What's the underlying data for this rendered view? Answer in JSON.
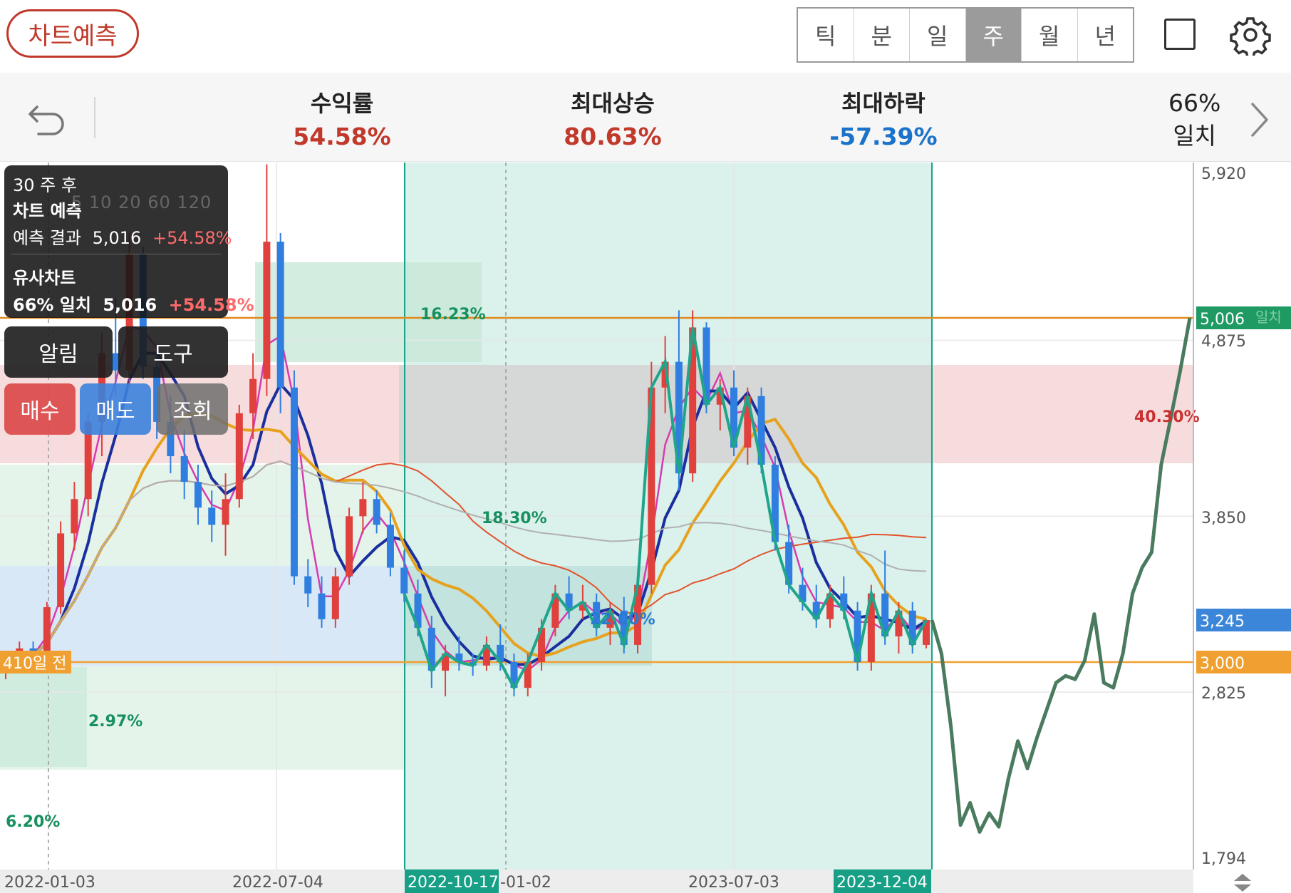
{
  "header": {
    "predict_button": "차트예측",
    "periods": [
      "틱",
      "분",
      "일",
      "주",
      "월",
      "년"
    ],
    "active_period": "주"
  },
  "stats": {
    "return": {
      "label": "수익률",
      "value": "54.58%"
    },
    "max_rise": {
      "label": "최대상승",
      "value": "80.63%"
    },
    "max_fall": {
      "label": "최대하락",
      "value": "-57.39%"
    },
    "match_pct": "66%",
    "match_label": "일치"
  },
  "overlay": {
    "period": "30 주 후",
    "title": "차트 예측",
    "result_label": "예측 결과",
    "result_value": "5,016",
    "result_pct": "+54.58%",
    "similar_title": "유사차트",
    "similar_label": "66% 일치",
    "similar_value": "5,016",
    "similar_pct": "+54.58%",
    "ma_legend": "5  10  20  60  120",
    "buttons": {
      "alert": "알림",
      "tool": "도구",
      "buy": "매수",
      "sell": "매도",
      "inquiry": "조회"
    }
  },
  "chart_data": {
    "type": "candlestick",
    "period": "weekly",
    "y_ticks": [
      "5,920",
      "4,875",
      "3,850",
      "2,825",
      "1,794"
    ],
    "x_ticks": [
      "2022-01-03",
      "2022-07-04",
      "2022-10-17",
      "-01-02",
      "2023-07-03",
      "2023-12-04"
    ],
    "price_tags": [
      {
        "value": "5,006",
        "label": "일치",
        "color": "#1f9a63"
      },
      {
        "value": "3,245",
        "color": "#3b86d8"
      },
      {
        "value": "3,000",
        "color": "#f0a030"
      }
    ],
    "left_tag": "410일 전",
    "zone_percents": [
      "16.23%",
      "18.30%",
      "22.00%",
      "2.97%",
      "6.20%",
      "40.30%"
    ],
    "ohlc": [
      [
        2950,
        3060,
        2900,
        2990
      ],
      [
        2990,
        3120,
        2960,
        3080
      ],
      [
        3080,
        3120,
        3010,
        3050
      ],
      [
        3050,
        3350,
        3030,
        3320
      ],
      [
        3320,
        3820,
        3280,
        3750
      ],
      [
        3750,
        4050,
        3650,
        3950
      ],
      [
        3950,
        4450,
        3850,
        4400
      ],
      [
        4400,
        4920,
        4200,
        4800
      ],
      [
        4800,
        5120,
        4550,
        4700
      ],
      [
        4700,
        5500,
        4600,
        5380
      ],
      [
        5380,
        5420,
        4650,
        4720
      ],
      [
        4720,
        4800,
        4300,
        4400
      ],
      [
        4400,
        4550,
        4100,
        4200
      ],
      [
        4200,
        4350,
        3950,
        4050
      ],
      [
        4050,
        4150,
        3800,
        3900
      ],
      [
        3900,
        4000,
        3700,
        3800
      ],
      [
        3800,
        4100,
        3620,
        3950
      ],
      [
        3950,
        4500,
        3900,
        4450
      ],
      [
        4450,
        4800,
        4300,
        4650
      ],
      [
        4650,
        5900,
        4550,
        5450
      ],
      [
        5450,
        5500,
        4450,
        4600
      ],
      [
        4600,
        4700,
        3450,
        3500
      ],
      [
        3500,
        3600,
        3320,
        3400
      ],
      [
        3400,
        3500,
        3200,
        3250
      ],
      [
        3250,
        3550,
        3200,
        3500
      ],
      [
        3500,
        3900,
        3450,
        3850
      ],
      [
        3850,
        4050,
        3750,
        3950
      ],
      [
        3950,
        4000,
        3750,
        3800
      ],
      [
        3800,
        3870,
        3500,
        3550
      ],
      [
        3550,
        3650,
        3350,
        3400
      ],
      [
        3400,
        3480,
        3150,
        3200
      ],
      [
        3200,
        3270,
        2850,
        2950
      ],
      [
        2950,
        3100,
        2800,
        3050
      ],
      [
        3050,
        3150,
        2950,
        3000
      ],
      [
        3000,
        3050,
        2920,
        2980
      ],
      [
        2980,
        3150,
        2950,
        3100
      ],
      [
        3100,
        3220,
        2950,
        3000
      ],
      [
        3000,
        3050,
        2800,
        2850
      ],
      [
        2850,
        3050,
        2800,
        3000
      ],
      [
        3000,
        3250,
        2950,
        3200
      ],
      [
        3200,
        3450,
        3150,
        3400
      ],
      [
        3400,
        3500,
        3250,
        3300
      ],
      [
        3300,
        3450,
        3250,
        3350
      ],
      [
        3350,
        3400,
        3150,
        3200
      ],
      [
        3200,
        3350,
        3100,
        3300
      ],
      [
        3300,
        3380,
        3050,
        3100
      ],
      [
        3100,
        3500,
        3050,
        3450
      ],
      [
        3450,
        4750,
        3400,
        4600
      ],
      [
        4600,
        4900,
        4450,
        4750
      ],
      [
        4750,
        5050,
        4000,
        4100
      ],
      [
        4100,
        5050,
        4050,
        4950
      ],
      [
        4950,
        4980,
        4450,
        4500
      ],
      [
        4500,
        4650,
        4350,
        4600
      ],
      [
        4600,
        4700,
        4200,
        4250
      ],
      [
        4250,
        4600,
        4150,
        4550
      ],
      [
        4550,
        4600,
        4100,
        4150
      ],
      [
        4150,
        4200,
        3650,
        3700
      ],
      [
        3700,
        3800,
        3400,
        3450
      ],
      [
        3450,
        3550,
        3300,
        3350
      ],
      [
        3350,
        3450,
        3200,
        3250
      ],
      [
        3250,
        3450,
        3200,
        3400
      ],
      [
        3400,
        3500,
        3250,
        3300
      ],
      [
        3300,
        3350,
        2950,
        3000
      ],
      [
        3000,
        3450,
        2950,
        3400
      ],
      [
        3400,
        3650,
        3100,
        3150
      ],
      [
        3150,
        3350,
        3050,
        3300
      ],
      [
        3300,
        3350,
        3050,
        3100
      ],
      [
        3100,
        3250,
        3080,
        3245
      ]
    ],
    "prediction_path": [
      3245,
      3050,
      2620,
      2050,
      2180,
      2010,
      2120,
      2040,
      2320,
      2540,
      2380,
      2560,
      2720,
      2880,
      2920,
      2900,
      3010,
      3280,
      2880,
      2850,
      3050,
      3400,
      3550,
      3640,
      4150,
      4420,
      4700,
      5006
    ]
  }
}
